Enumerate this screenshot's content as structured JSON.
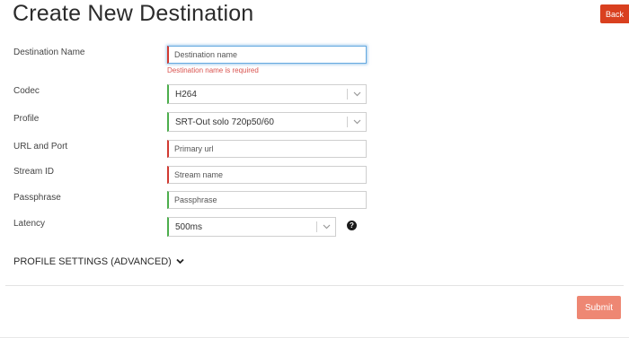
{
  "page": {
    "title": "Create New Destination",
    "back_label": "Back"
  },
  "form": {
    "destination_name": {
      "label": "Destination Name",
      "placeholder": "Destination name",
      "error": "Destination name is required"
    },
    "codec": {
      "label": "Codec",
      "value": "H264"
    },
    "profile": {
      "label": "Profile",
      "value": "SRT-Out solo 720p50/60"
    },
    "url_port": {
      "label": "URL and Port",
      "placeholder": "Primary url"
    },
    "stream_id": {
      "label": "Stream ID",
      "placeholder": "Stream name"
    },
    "passphrase": {
      "label": "Passphrase",
      "placeholder": "Passphrase"
    },
    "latency": {
      "label": "Latency",
      "value": "500ms",
      "help_glyph": "?"
    }
  },
  "advanced": {
    "label": "PROFILE SETTINGS (ADVANCED)"
  },
  "actions": {
    "submit_label": "Submit"
  },
  "icons": {
    "caret": "chevron-down-icon",
    "help": "question-circle-icon"
  },
  "colors": {
    "error": "#d13a32",
    "valid": "#4cae4c",
    "danger_button": "#d9401f",
    "submit_button": "#ee8773"
  }
}
